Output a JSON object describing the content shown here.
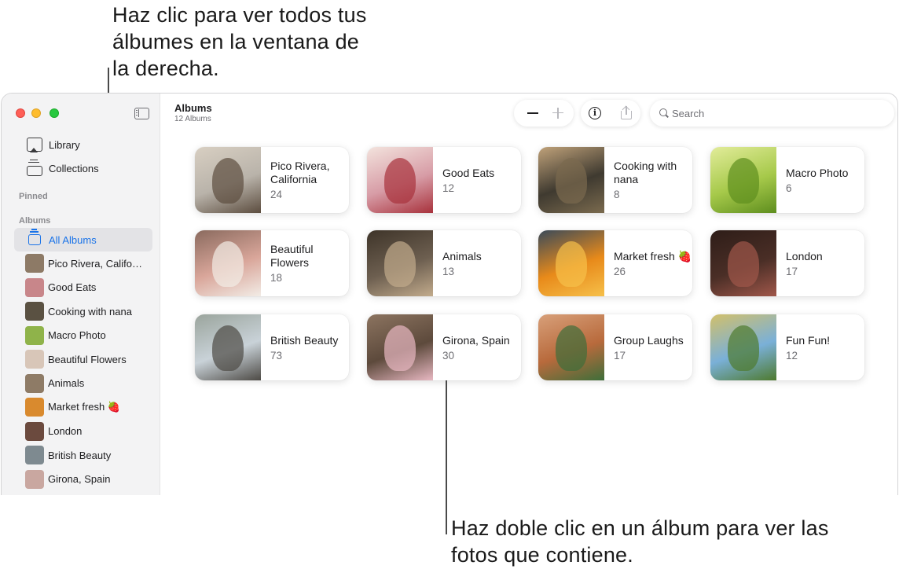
{
  "callouts": {
    "top": "Haz clic para ver todos tus álbumes en la ventana de la derecha.",
    "bottom": "Haz doble clic en un álbum para ver las fotos que contiene."
  },
  "sidebar": {
    "nav": [
      {
        "label": "Library",
        "icon": "photo-library-icon"
      },
      {
        "label": "Collections",
        "icon": "collections-stack-icon"
      }
    ],
    "pinned_header": "Pinned",
    "albums_header": "Albums",
    "all_albums_label": "All Albums",
    "albums": [
      {
        "label": "Pico Rivera, California",
        "thumb": "#8d7a66"
      },
      {
        "label": "Good Eats",
        "thumb": "#c8868a"
      },
      {
        "label": "Cooking with nana",
        "thumb": "#5a5142"
      },
      {
        "label": "Macro Photo",
        "thumb": "#8fb34a"
      },
      {
        "label": "Beautiful Flowers",
        "thumb": "#d8c6b8"
      },
      {
        "label": "Animals",
        "thumb": "#8e7b66"
      },
      {
        "label": "Market fresh 🍓",
        "thumb": "#d98a2e"
      },
      {
        "label": "London",
        "thumb": "#6b4a3e"
      },
      {
        "label": "British Beauty",
        "thumb": "#7e8a90"
      },
      {
        "label": "Girona, Spain",
        "thumb": "#c9a7a0"
      }
    ]
  },
  "toolbar": {
    "title": "Albums",
    "subtitle": "12 Albums",
    "search_placeholder": "Search",
    "info_glyph": "i"
  },
  "grid": {
    "albums": [
      {
        "title": "Pico Rivera, California",
        "count": "24",
        "colors": [
          "#b9b3aa",
          "#5c4d3f",
          "#d8cfc2"
        ]
      },
      {
        "title": "Good Eats",
        "count": "12",
        "colors": [
          "#d79ca6",
          "#a8323c",
          "#f3e3dd"
        ]
      },
      {
        "title": "Cooking with nana",
        "count": "8",
        "colors": [
          "#3f3a30",
          "#7a6a4e",
          "#c0a27a"
        ]
      },
      {
        "title": "Macro Photo",
        "count": "6",
        "colors": [
          "#a6c94a",
          "#5e8e1e",
          "#e2ec9a"
        ]
      },
      {
        "title": "Beautiful Flowers",
        "count": "18",
        "colors": [
          "#d9a69a",
          "#f2ece6",
          "#8a6a5e"
        ]
      },
      {
        "title": "Animals",
        "count": "13",
        "colors": [
          "#6d5f50",
          "#c2ab8c",
          "#3e3429"
        ]
      },
      {
        "title": "Market fresh 🍓",
        "count": "26",
        "colors": [
          "#e88a1a",
          "#f6c04a",
          "#3a4a5a"
        ]
      },
      {
        "title": "London",
        "count": "17",
        "colors": [
          "#4a2e26",
          "#a0574a",
          "#2e1d18"
        ]
      },
      {
        "title": "British Beauty",
        "count": "73",
        "colors": [
          "#c9d2d8",
          "#4d4a45",
          "#9aa49c"
        ]
      },
      {
        "title": "Girona, Spain",
        "count": "30",
        "colors": [
          "#5d4a3c",
          "#e8b8c2",
          "#8c7460"
        ]
      },
      {
        "title": "Group Laughs",
        "count": "17",
        "colors": [
          "#b86a3c",
          "#3e6e3a",
          "#d8a07a"
        ]
      },
      {
        "title": "Fun Fun!",
        "count": "12",
        "colors": [
          "#7ab0d8",
          "#4e7a2e",
          "#d2c06a"
        ]
      }
    ]
  }
}
